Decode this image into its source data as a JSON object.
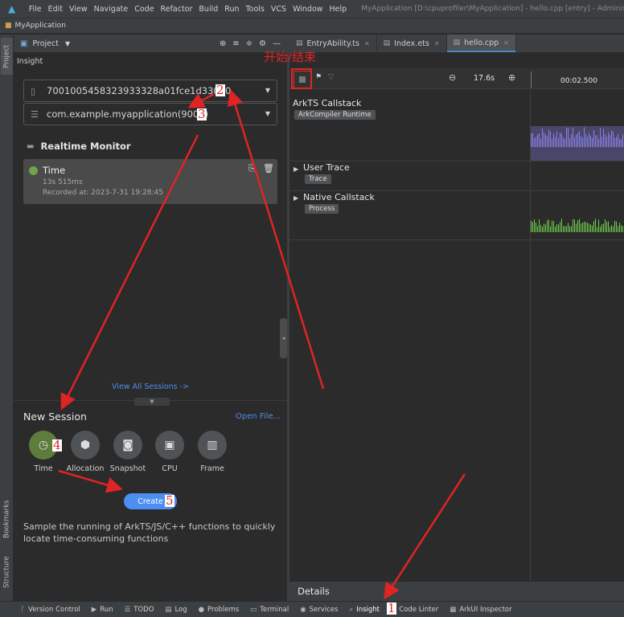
{
  "menubar": {
    "items": [
      "File",
      "Edit",
      "View",
      "Navigate",
      "Code",
      "Refactor",
      "Build",
      "Run",
      "Tools",
      "VCS",
      "Window",
      "Help"
    ],
    "window_title": "MyApplication [D:\\cpuprofiler\\MyApplication] - hello.cpp [entry] - Administ"
  },
  "project": {
    "name": "MyApplication"
  },
  "left_stripe": {
    "tabs": [
      "Project",
      "Bookmarks",
      "Structure"
    ]
  },
  "panel": {
    "title": "Project",
    "insight_label": "Insight",
    "device": "7001005458323933328a01fce1d33090",
    "process": "com.example.myapplication(9001)",
    "realtime_monitor": "Realtime Monitor",
    "session": {
      "name": "Time",
      "duration": "13s 515ms",
      "recorded": "Recorded at: 2023-7-31 19:28:45",
      "status_color": "#6da548"
    },
    "view_all": "View All Sessions ->",
    "new_session_title": "New Session",
    "open_file": "Open File...",
    "session_types": [
      {
        "label": "Time",
        "icon": "clock-icon",
        "selected": true
      },
      {
        "label": "Allocation",
        "icon": "box-icon",
        "selected": false
      },
      {
        "label": "Snapshot",
        "icon": "camera-icon",
        "selected": false
      },
      {
        "label": "CPU",
        "icon": "chip-icon",
        "selected": false
      },
      {
        "label": "Frame",
        "icon": "frame-icon",
        "selected": false
      }
    ],
    "create_label": "Create",
    "description": "Sample the running of ArkTS/JS/C++ functions to quickly locate time-consuming functions"
  },
  "editor_tabs": [
    {
      "label": "EntryAbility.ts",
      "active": false
    },
    {
      "label": "Index.ets",
      "active": false
    },
    {
      "label": "hello.cpp",
      "active": true
    }
  ],
  "timeline": {
    "zoom": "17.6s",
    "ruler_tick": "00:02.500",
    "tracks": [
      {
        "title": "ArkTS Callstack",
        "tag": "ArkCompiler Runtime",
        "expanded": true
      },
      {
        "title": "User Trace",
        "tag": "Trace",
        "expanded": false
      },
      {
        "title": "Native Callstack",
        "tag": "Process",
        "expanded": false
      }
    ],
    "colors": {
      "arkts": "#8a83e8",
      "native": "#6fcf4a"
    }
  },
  "details": {
    "label": "Details"
  },
  "statusbar": {
    "items": [
      {
        "label": "Version Control",
        "icon": "branch-icon"
      },
      {
        "label": "Run",
        "icon": "play-icon"
      },
      {
        "label": "TODO",
        "icon": "list-icon"
      },
      {
        "label": "Log",
        "icon": "log-icon"
      },
      {
        "label": "Problems",
        "icon": "info-icon"
      },
      {
        "label": "Terminal",
        "icon": "terminal-icon"
      },
      {
        "label": "Services",
        "icon": "services-icon"
      },
      {
        "label": "Insight",
        "icon": "insight-icon"
      },
      {
        "label": "Code Linter",
        "icon": "linter-icon"
      },
      {
        "label": "ArkUI Inspector",
        "icon": "inspector-icon"
      }
    ]
  },
  "annotations": {
    "start_end": "开始/结束",
    "steps": [
      "1",
      "2",
      "3",
      "4",
      "5"
    ],
    "color": "#e02424"
  }
}
